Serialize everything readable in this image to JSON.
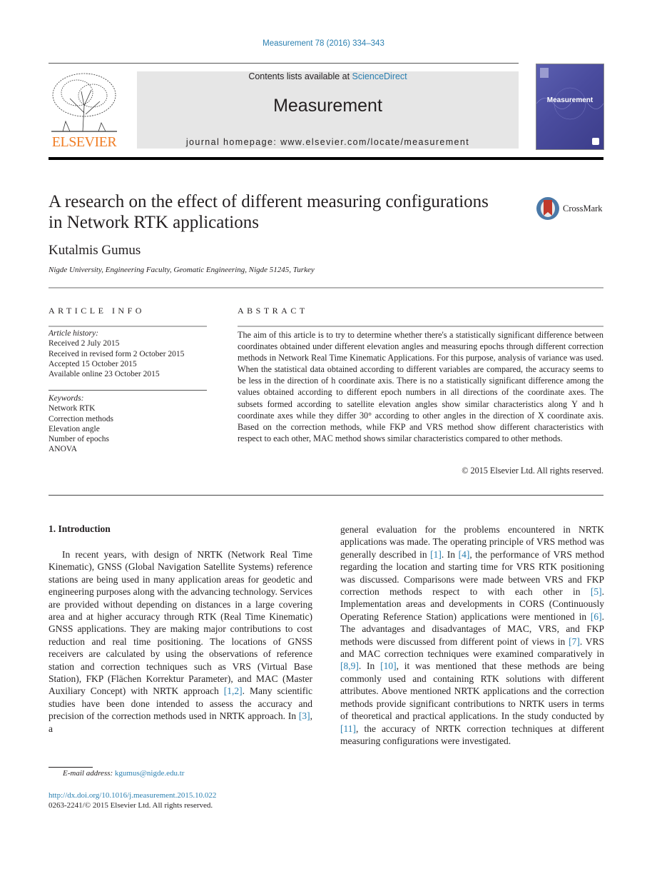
{
  "header": {
    "citation": "Measurement 78 (2016) 334–343",
    "contents_prefix": "Contents lists available at ",
    "contents_link": "ScienceDirect",
    "journal_name": "Measurement",
    "homepage": "journal homepage: www.elsevier.com/locate/measurement",
    "publisher_logo_text": "ELSEVIER",
    "cover_title": "Measurement"
  },
  "article": {
    "title_line1": "A research on the effect of different measuring configurations",
    "title_line2": "in Network RTK applications",
    "crossmark_label": "CrossMark",
    "author": "Kutalmis Gumus",
    "affiliation": "Nigde University, Engineering Faculty, Geomatic Engineering, Nigde 51245, Turkey"
  },
  "article_info": {
    "heading": "ARTICLE INFO",
    "history_label": "Article history:",
    "history": [
      "Received 2 July 2015",
      "Received in revised form 2 October 2015",
      "Accepted 15 October 2015",
      "Available online 23 October 2015"
    ],
    "keywords_label": "Keywords:",
    "keywords": [
      "Network RTK",
      "Correction methods",
      "Elevation angle",
      "Number of epochs",
      "ANOVA"
    ]
  },
  "abstract": {
    "heading": "ABSTRACT",
    "text": "The aim of this article is to try to determine whether there's a statistically significant difference between coordinates obtained under different elevation angles and measuring epochs through different correction methods in Network Real Time Kinematic Applications. For this purpose, analysis of variance was used. When the statistical data obtained according to different variables are compared, the accuracy seems to be less in the direction of h coordinate axis. There is no a statistically significant difference among the values obtained according to different epoch numbers in all directions of the coordinate axes. The subsets formed according to satellite elevation angles show similar characteristics along Y and h coordinate axes while they differ 30° according to other angles in the direction of X coordinate axis. Based on the correction methods, while FKP and VRS method show different characteristics with respect to each other, MAC method shows similar characteristics compared to other methods.",
    "copyright": "© 2015 Elsevier Ltd. All rights reserved."
  },
  "introduction": {
    "heading": "1. Introduction",
    "left_segments": [
      {
        "t": "In recent years, with design of NRTK (Network Real Time Kinematic), GNSS (Global Navigation Satellite Systems) reference stations are being used in many application areas for geodetic and engineering purposes along with the advancing technology. Services are provided without depending on distances in a large covering area and at higher accuracy through RTK (Real Time Kinematic) GNSS applications. They are making major contributions to cost reduction and real time positioning. The locations of GNSS receivers are calculated by using the observations of reference station and correction techniques such as VRS (Virtual Base Station), FKP (Flächen Korrektur Parameter), and MAC (Master Auxiliary Concept) with NRTK approach "
      },
      {
        "ref": "[1,2]"
      },
      {
        "t": ". Many scientific studies have been done intended to assess the accuracy and precision of the correction methods used in NRTK approach. In "
      },
      {
        "ref": "[3]"
      },
      {
        "t": ", a"
      }
    ],
    "right_segments": [
      {
        "t": "general evaluation for the problems encountered in NRTK applications was made. The operating principle of VRS method was generally described in "
      },
      {
        "ref": "[1]"
      },
      {
        "t": ". In "
      },
      {
        "ref": "[4]"
      },
      {
        "t": ", the performance of VRS method regarding the location and starting time for VRS RTK positioning was discussed. Comparisons were made between VRS and FKP correction methods respect to with each other in "
      },
      {
        "ref": "[5]"
      },
      {
        "t": ". Implementation areas and developments in CORS (Continuously Operating Reference Station) applications were mentioned in "
      },
      {
        "ref": "[6]"
      },
      {
        "t": ". The advantages and disadvantages of MAC, VRS, and FKP methods were discussed from different point of views in "
      },
      {
        "ref": "[7]"
      },
      {
        "t": ". VRS and MAC correction techniques were examined comparatively in "
      },
      {
        "ref": "[8,9]"
      },
      {
        "t": ". In "
      },
      {
        "ref": "[10]"
      },
      {
        "t": ", it was mentioned that these methods are being commonly used and containing RTK solutions with different attributes. Above mentioned NRTK applications and the correction methods provide significant contributions to NRTK users in terms of theoretical and practical applications. In the study conducted by "
      },
      {
        "ref": "[11]"
      },
      {
        "t": ", the accuracy of NRTK correction techniques at different measuring configurations were investigated."
      }
    ]
  },
  "footer": {
    "email_label": "E-mail address: ",
    "email": "kgumus@nigde.edu.tr",
    "doi": "http://dx.doi.org/10.1016/j.measurement.2015.10.022",
    "issn": "0263-2241/© 2015 Elsevier Ltd. All rights reserved."
  },
  "colors": {
    "link": "#2a7fb0",
    "publisher_orange": "#f07e26",
    "banner_gray": "#e6e6e6",
    "cover_blue": "#4a4c9e"
  }
}
